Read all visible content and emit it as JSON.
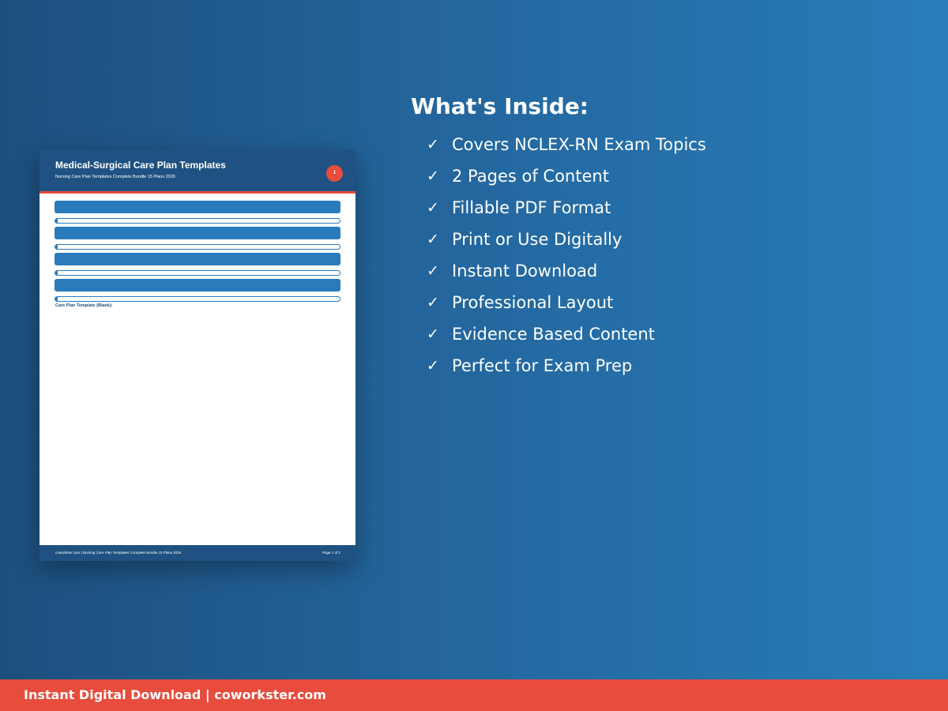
{
  "document_preview": {
    "title": "Medical-Surgical Care Plan Templates",
    "subtitle": "Nursing Care Plan Templates Complete Bundle 15 Plans 2026",
    "page_badge": "1",
    "section_label": "Care Plan Template (Blank):",
    "footer_left": "coworkster.com | Nursing Care Plan Templates Complete Bundle 15 Plans 2026",
    "footer_right": "Page 1 of 2"
  },
  "features": {
    "heading": "What's Inside:",
    "check_icon": "check-icon",
    "check_glyph": "✓",
    "items": [
      "Covers NCLEX-RN Exam Topics",
      "2 Pages of Content",
      "Fillable PDF Format",
      "Print or Use Digitally",
      "Instant Download",
      "Professional Layout",
      "Evidence Based Content",
      "Perfect for Exam Prep"
    ]
  },
  "banner": {
    "text": "Instant Digital Download | coworkster.com"
  },
  "colors": {
    "background_left": "#1d4f7e",
    "background_right": "#287db9",
    "doc_header": "#1f5282",
    "doc_bar": "#2a7bbc",
    "accent_red": "#e74c3c"
  }
}
